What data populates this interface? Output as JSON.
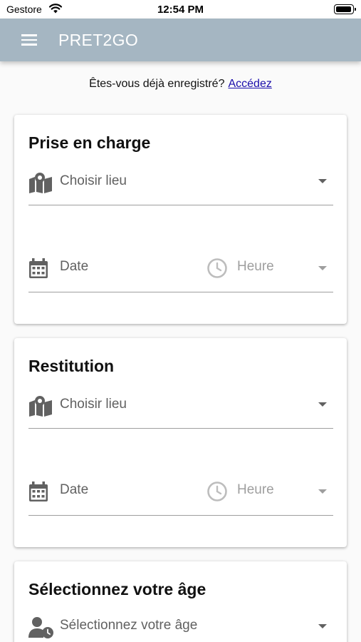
{
  "status_bar": {
    "carrier": "Gestore",
    "time": "12:54 PM"
  },
  "app_bar": {
    "title": "PRET2GO",
    "menu_icon": "hamburger-menu-icon"
  },
  "login_prompt": {
    "text": "Êtes-vous déjà enregistré?",
    "link": "Accédez"
  },
  "pickup": {
    "title": "Prise en charge",
    "location": {
      "placeholder": "Choisir lieu",
      "icon": "map-marker-icon"
    },
    "date": {
      "placeholder": "Date",
      "icon": "calendar-icon"
    },
    "time": {
      "placeholder": "Heure",
      "icon": "clock-icon"
    }
  },
  "return": {
    "title": "Restitution",
    "location": {
      "placeholder": "Choisir lieu",
      "icon": "map-marker-icon"
    },
    "date": {
      "placeholder": "Date",
      "icon": "calendar-icon"
    },
    "time": {
      "placeholder": "Heure",
      "icon": "clock-icon"
    }
  },
  "age": {
    "title": "Sélectionnez votre âge",
    "select": {
      "placeholder": "Sélectionnez votre âge",
      "icon": "user-clock-icon"
    }
  },
  "colors": {
    "app_bar": "#a5b6c2",
    "link": "#1a0dab",
    "text": "#212121",
    "muted": "#616161",
    "underline": "#9e9e9e"
  }
}
